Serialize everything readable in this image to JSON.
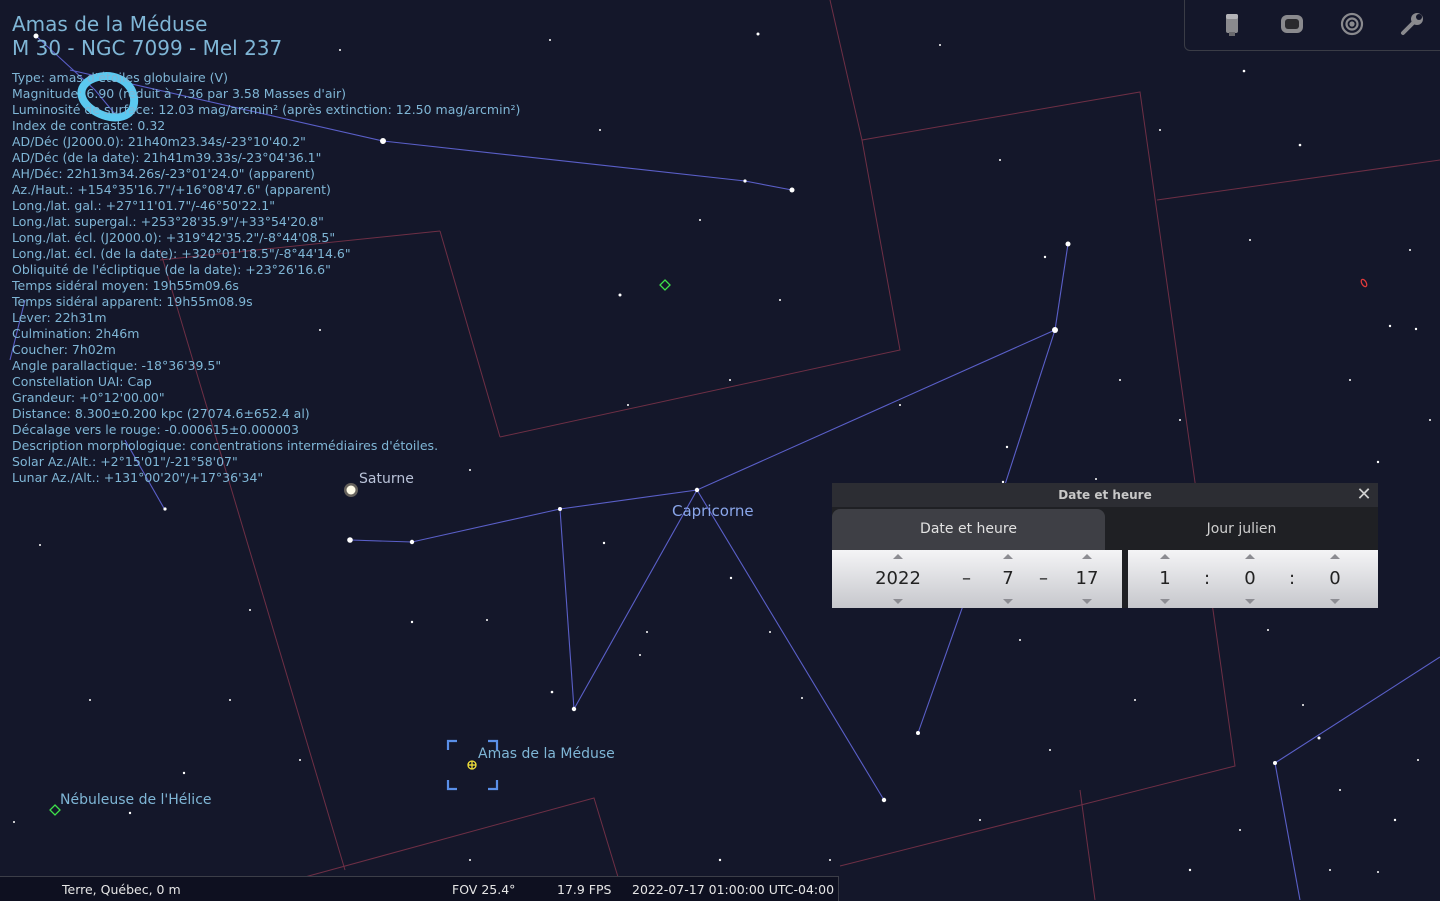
{
  "object": {
    "title_line1": "Amas de la Méduse",
    "title_line2": "M 30 - NGC 7099 - Mel 237",
    "lines": [
      "Type: amas d'étoiles globulaire (V)",
      "Magnitude: 6.90 (réduit à 7.36 par 3.58 Masses d'air)",
      "Luminosité de surface: 12.03 mag/arcmin² (après extinction: 12.50 mag/arcmin²)",
      "Index de contraste: 0.32",
      "AD/Déc (J2000.0): 21h40m23.34s/-23°10'40.2\"",
      "AD/Déc (de la date): 21h41m39.33s/-23°04'36.1\"",
      "AH/Déc: 22h13m34.26s/-23°01'24.0\" (apparent)",
      "Az./Haut.: +154°35'16.7\"/+16°08'47.6\" (apparent)",
      "Long./lat. gal.: +27°11'01.7\"/-46°50'22.1\"",
      "Long./lat. supergal.: +253°28'35.9\"/+33°54'20.8\"",
      "Long./lat. écl. (J2000.0): +319°42'35.2\"/-8°44'08.5\"",
      "Long./lat. écl. (de la date): +320°01'18.5\"/-8°44'14.6\"",
      "Obliquité de l'écliptique (de la date): +23°26'16.6\"",
      "Temps sidéral moyen: 19h55m09.6s",
      "Temps sidéral apparent: 19h55m08.9s",
      "Lever: 22h31m",
      "Culmination: 2h46m",
      "Coucher: 7h02m",
      "Angle parallactique: -18°36'39.5\"",
      "Constellation UAI: Cap",
      "Grandeur: +0°12'00.00\"",
      "Distance: 8.300±0.200 kpc (27074.6±652.4 al)",
      "Décalage vers le rouge: -0.000615±0.000003",
      "Description morphologique: concentrations intermédiaires d'étoiles.",
      "Solar Az./Alt.: +2°15'01\"/-21°58'07\"",
      "Lunar Az./Alt.: +131°00'20\"/+17°36'34\""
    ]
  },
  "sky_labels": {
    "saturn": "Saturne",
    "capricorn": "Capricorne",
    "cluster": "Amas de la Méduse",
    "helix": "Nébuleuse de l'Hélice"
  },
  "toolbar": {
    "icons": [
      "telescope-icon",
      "ocular-icon",
      "sensor-icon",
      "wrench-icon"
    ]
  },
  "status_bar": {
    "location": "Terre, Québec, 0 m",
    "fov": "FOV 25.4°",
    "fps": "17.9 FPS",
    "datetime": "2022-07-17 01:00:00 UTC-04:00"
  },
  "date_dialog": {
    "title": "Date et heure",
    "close": "✕",
    "tab_date": "Date et heure",
    "tab_julian": "Jour julien",
    "year": "2022",
    "month": "7",
    "day": "17",
    "hour": "1",
    "minute": "0",
    "second": "0",
    "date_sep": "–",
    "time_sep": ":"
  },
  "colors": {
    "sky": "#14172a",
    "info_text": "#7fb6d6",
    "constellation_line": "#5a5fc8",
    "boundary_line": "#6e2f45",
    "label_blue": "#7fb6d6",
    "nebula_green": "#3ee04a",
    "marker_yellow": "#f2e23a",
    "annotation_cyan": "#5bc9f0"
  }
}
